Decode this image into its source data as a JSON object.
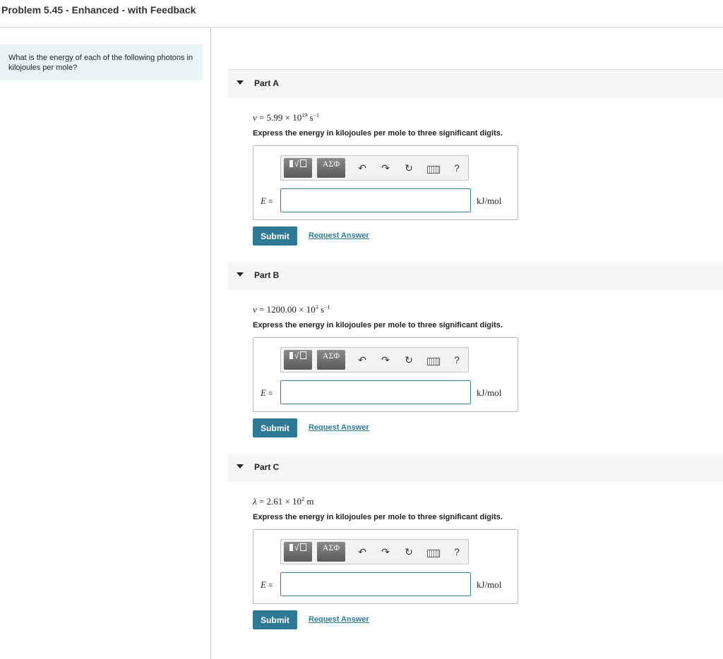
{
  "page_title": "Problem 5.45 - Enhanced - with Feedback",
  "question": "What is the energy of each of the following photons in kilojoules per mole?",
  "toolbar": {
    "template_label": "√",
    "symbols_label": "ΑΣΦ",
    "help_label": "?",
    "undo_icon": "↶",
    "redo_icon": "↷",
    "reset_icon": "↻"
  },
  "parts": [
    {
      "label": "Part A",
      "given_var": "ν",
      "given_eq": " = 5.99 × 10",
      "given_exp": "19",
      "given_unit": " s",
      "given_unit_exp": "−1",
      "instruction": "Express the energy in kilojoules per mole to three significant digits.",
      "answer_var": "E",
      "answer_eq": " =",
      "answer_value": "",
      "units": "kJ/mol",
      "submit": "Submit",
      "request": "Request Answer"
    },
    {
      "label": "Part B",
      "given_var": "ν",
      "given_eq": " = 1200.00 × 10",
      "given_exp": "3",
      "given_unit": " s",
      "given_unit_exp": "−1",
      "instruction": "Express the energy in kilojoules per mole to three significant digits.",
      "answer_var": "E",
      "answer_eq": " =",
      "answer_value": "",
      "units": "kJ/mol",
      "submit": "Submit",
      "request": "Request Answer"
    },
    {
      "label": "Part C",
      "given_var": "λ",
      "given_eq": " = 2.61 × 10",
      "given_exp": "2",
      "given_unit": " m",
      "given_unit_exp": "",
      "instruction": "Express the energy in kilojoules per mole to three significant digits.",
      "answer_var": "E",
      "answer_eq": " =",
      "answer_value": "",
      "units": "kJ/mol",
      "submit": "Submit",
      "request": "Request Answer"
    }
  ]
}
